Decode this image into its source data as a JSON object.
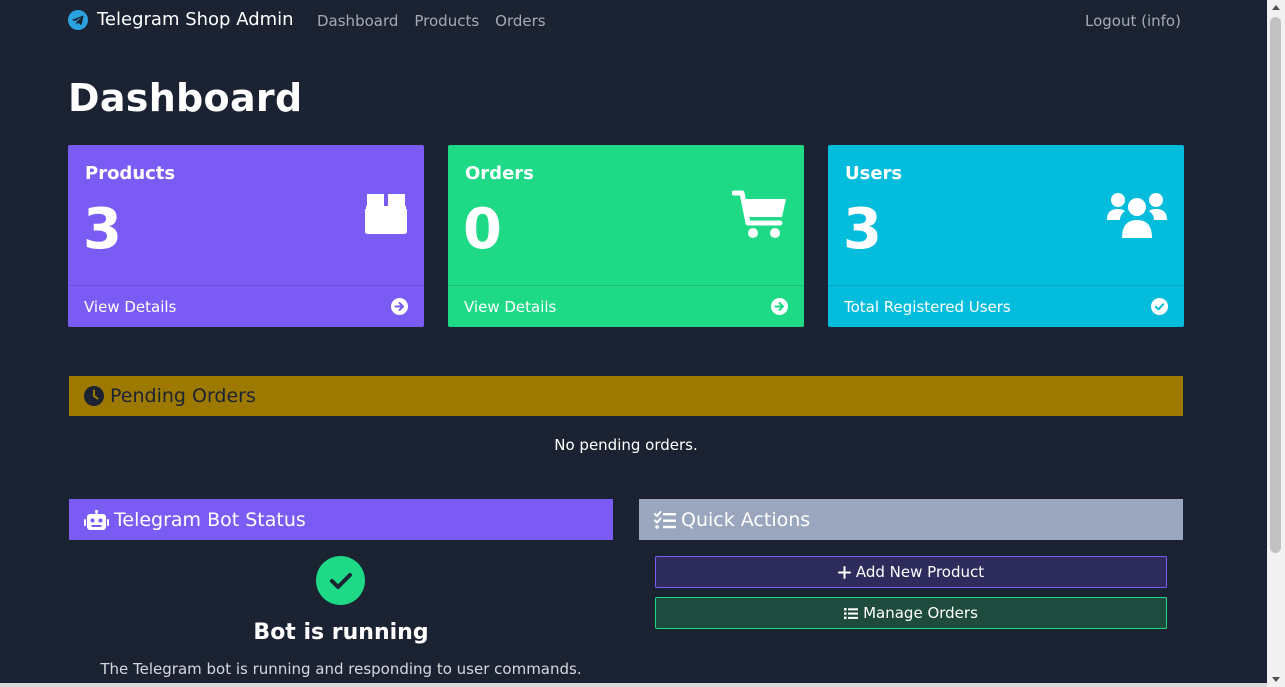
{
  "navbar": {
    "brand": "Telegram Shop Admin",
    "links": [
      "Dashboard",
      "Products",
      "Orders"
    ],
    "logout": "Logout (info)"
  },
  "page": {
    "title": "Dashboard"
  },
  "cards": {
    "products": {
      "title": "Products",
      "value": "3",
      "footer": "View Details",
      "icon": "box-icon",
      "footer_icon": "arrow-circle-right-icon",
      "color": "#7a5cf5"
    },
    "orders": {
      "title": "Orders",
      "value": "0",
      "footer": "View Details",
      "icon": "cart-icon",
      "footer_icon": "arrow-circle-right-icon",
      "color": "#1ed986"
    },
    "users": {
      "title": "Users",
      "value": "3",
      "footer": "Total Registered Users",
      "icon": "users-icon",
      "footer_icon": "check-circle-icon",
      "color": "#04bcdc"
    }
  },
  "pending_orders": {
    "title": "Pending Orders",
    "empty_message": "No pending orders.",
    "icon": "clock-icon",
    "color": "#9e7900"
  },
  "bot_status": {
    "title": "Telegram Bot Status",
    "status": "Bot is running",
    "description": "The Telegram bot is running and responding to user commands.",
    "icon": "robot-icon",
    "status_icon": "check-circle-icon"
  },
  "quick_actions": {
    "title": "Quick Actions",
    "icon": "tasks-icon",
    "add_product": "Add New Product",
    "manage_orders": "Manage Orders"
  }
}
